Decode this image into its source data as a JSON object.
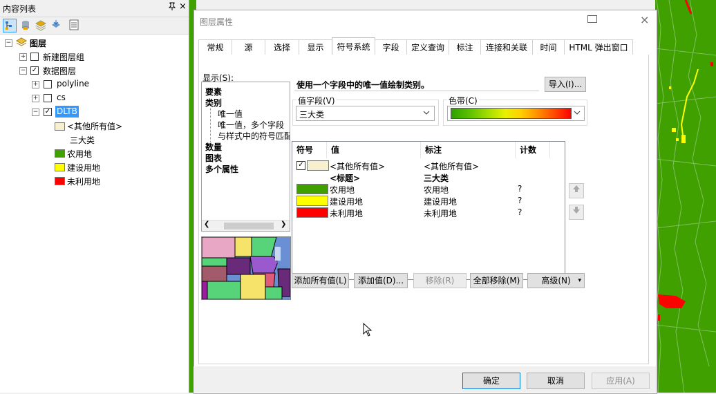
{
  "toc": {
    "title": "内容列表",
    "pin_icon": "pin-icon",
    "close": "×",
    "root": "图层",
    "layers": [
      {
        "label": "新建图层组",
        "checked": false,
        "expanded": false
      },
      {
        "label": "数据图层",
        "checked": true,
        "expanded": true
      },
      {
        "label": "polyline",
        "checked": false,
        "expanded": false
      },
      {
        "label": "cs",
        "checked": false,
        "expanded": false
      },
      {
        "label": "DLTB",
        "checked": true,
        "expanded": true
      }
    ],
    "legend": [
      {
        "label": "<其他所有值>",
        "color": "#f7f0cf"
      },
      {
        "label": "三大类",
        "color": ""
      },
      {
        "label": "农用地",
        "color": "#3fa000"
      },
      {
        "label": "建设用地",
        "color": "#ffff00"
      },
      {
        "label": "未利用地",
        "color": "#ff0000"
      }
    ]
  },
  "dialog": {
    "title": "图层属性",
    "close": "×",
    "tabs": [
      "常规",
      "源",
      "选择",
      "显示",
      "符号系统",
      "字段",
      "定义查询",
      "标注",
      "连接和关联",
      "时间",
      "HTML 弹出窗口"
    ],
    "active_tab": "符号系统",
    "show_label": "显示(S):",
    "tree": {
      "features": "要素",
      "categories": "类别",
      "cat_items": [
        "唯一值",
        "唯一值，多个字段",
        "与样式中的符号匹配"
      ],
      "quantities": "数量",
      "charts": "图表",
      "multi": "多个属性"
    },
    "heading": "使用一个字段中的唯一值绘制类别。",
    "import_btn": "导入(I)...",
    "value_field_label": "值字段(V)",
    "value_field": "三大类",
    "color_ramp_label": "色带(C)",
    "table": {
      "headers": [
        "符号",
        "值",
        "标注",
        "计数"
      ],
      "rows": [
        {
          "color": "#f7f0cf",
          "checked": true,
          "value": "<其他所有值>",
          "label": "<其他所有值>",
          "count": ""
        },
        {
          "color": "",
          "checked": false,
          "value": "<标题>",
          "label": "三大类",
          "count": "",
          "bold": true
        },
        {
          "color": "#3fa000",
          "checked": false,
          "value": "农用地",
          "label": "农用地",
          "count": "?"
        },
        {
          "color": "#ffff00",
          "checked": false,
          "value": "建设用地",
          "label": "建设用地",
          "count": "?"
        },
        {
          "color": "#ff0000",
          "checked": false,
          "value": "未利用地",
          "label": "未利用地",
          "count": "?"
        }
      ]
    },
    "buttons": {
      "add_all": "添加所有值(L)",
      "add_value": "添加值(D)...",
      "remove": "移除(R)",
      "remove_all": "全部移除(M)",
      "advanced": "高级(N)"
    },
    "footer": {
      "ok": "确定",
      "cancel": "取消",
      "apply": "应用(A)"
    }
  },
  "colors": {
    "accent": "#3399ff",
    "agri": "#3fa000",
    "build": "#ffff00",
    "unused": "#ff0000"
  }
}
